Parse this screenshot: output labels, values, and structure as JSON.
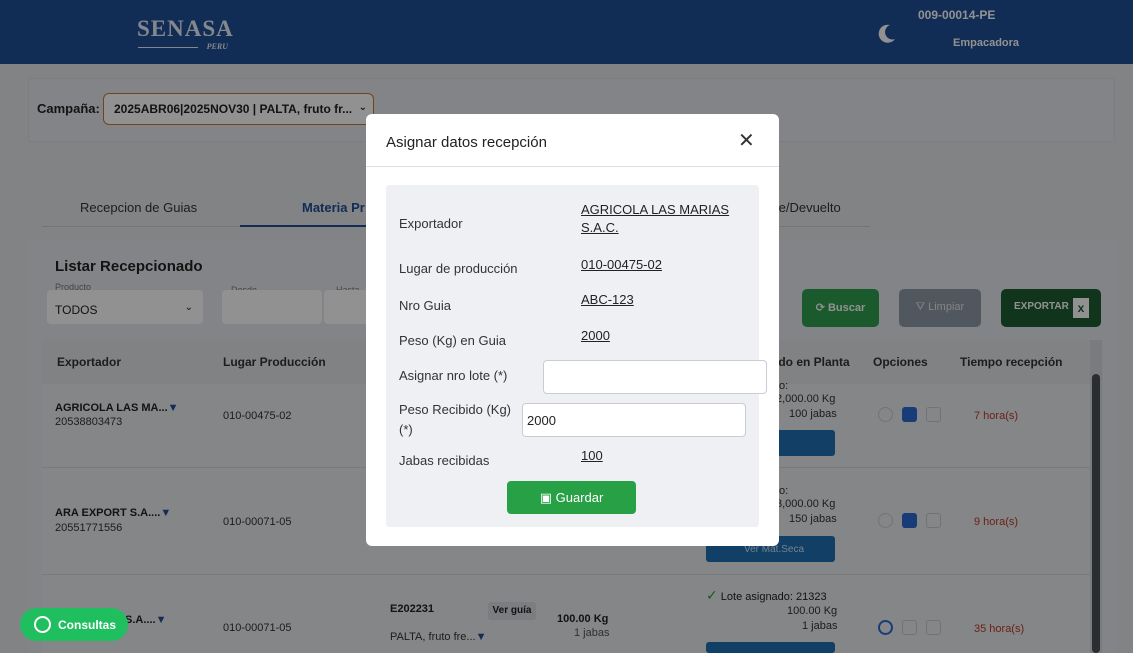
{
  "header": {
    "logo": "SENASA",
    "logo_sub": "PERU",
    "user_code": "009-00014-PE",
    "user_role": "Empacadora",
    "theme_icon": "moon-icon"
  },
  "campaign": {
    "label": "Campaña:",
    "value": "2025ABR06|2025NOV30 | PALTA, fruto fr...",
    "chevron": "⌄"
  },
  "tabs": [
    {
      "label": "Recepcion de Guias"
    },
    {
      "label": "Materia Pr"
    },
    {
      "label": "te/Devuelto"
    }
  ],
  "list": {
    "title": "Listar Recepcionado",
    "filters": {
      "producto_label": "Producto",
      "producto_value": "TODOS",
      "desde_label": "Desde",
      "hasta_label": "Hasta"
    },
    "buttons": {
      "buscar": "Buscar",
      "limpiar": "Limpiar",
      "exportar": "EXPORTAR"
    },
    "columns": {
      "exportador": "Exportador",
      "lugar": "Lugar Producción",
      "planta": "ido en Planta",
      "opciones": "Opciones",
      "tiempo": "Tiempo recepción"
    },
    "rows": [
      {
        "exportador": "AGRICOLA LAS MA...",
        "ruc": "20538803473",
        "lugar": "010-00475-02",
        "planta_head": "o:",
        "planta_kg": "2,000.00 Kg",
        "planta_jabas": "100 jabas",
        "ver_btn": "Seca",
        "tiempo": "7 hora(s)"
      },
      {
        "exportador": "ARA EXPORT S.A....",
        "ruc": "20551771556",
        "lugar": "010-00071-05",
        "planta_head": "o:",
        "planta_kg": "3,000.00 Kg",
        "planta_jabas": "150 jabas",
        "ver_btn": "Ver Mat.Seca",
        "tiempo": "9 hora(s)"
      },
      {
        "exportador": "S.A....",
        "lugar": "010-00071-05",
        "guia": "E202231",
        "ver_guia": "Ver guía",
        "producto": "PALTA, fruto fre...",
        "kg": "100.00 Kg",
        "jabas": "1 jabas",
        "lote": "Lote asignado: 21323",
        "planta_kg": "100.00 Kg",
        "planta_jabas": "1 jabas",
        "tiempo": "35 hora(s)"
      }
    ]
  },
  "modal": {
    "title": "Asignar datos recepción",
    "close": "✕",
    "fields": {
      "exportador_label": "Exportador",
      "exportador_line1": "AGRICOLA LAS MARIAS",
      "exportador_line2": "S.A.C.",
      "lugar_label": "Lugar de producción",
      "lugar_value": "010-00475-02",
      "guia_label": "Nro Guia",
      "guia_value": "ABC-123",
      "peso_guia_label": "Peso (Kg) en Guia",
      "peso_guia_value": "2000",
      "lote_label": "Asignar nro lote (*)",
      "lote_value": "",
      "peso_recibido_label_1": "Peso Recibido (Kg)",
      "peso_recibido_label_2": "(*)",
      "peso_recibido_value": "2000",
      "jabas_label": "Jabas recibidas",
      "jabas_value": "100"
    },
    "save_label": "Guardar"
  },
  "consultas": {
    "label": "Consultas"
  },
  "colors": {
    "header_bg": "#1f4e96",
    "accent_green": "#27a046",
    "export_green": "#1d5e32",
    "campaign_border": "#c77832",
    "time_red": "#c0392b"
  }
}
